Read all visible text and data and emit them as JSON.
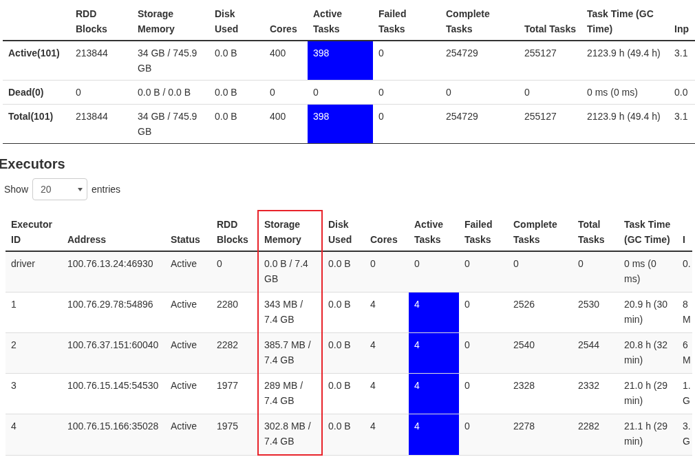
{
  "summary": {
    "columns": [
      "RDD Blocks",
      "Storage Memory",
      "Disk Used",
      "Cores",
      "Active Tasks",
      "Failed Tasks",
      "Complete Tasks",
      "Total Tasks",
      "Task Time (GC Time)",
      "Inp"
    ],
    "rows": [
      {
        "label": "Active(101)",
        "cells": [
          {
            "text": "213844"
          },
          {
            "text": "34 GB / 745.9 GB"
          },
          {
            "text": "0.0 B"
          },
          {
            "text": "400"
          },
          {
            "text": "398",
            "highlighted": true
          },
          {
            "text": "0"
          },
          {
            "text": "254729"
          },
          {
            "text": "255127"
          },
          {
            "text": "2123.9 h (49.4 h)"
          },
          {
            "text": "3.1"
          }
        ]
      },
      {
        "label": "Dead(0)",
        "cells": [
          {
            "text": "0"
          },
          {
            "text": "0.0 B / 0.0 B"
          },
          {
            "text": "0.0 B"
          },
          {
            "text": "0"
          },
          {
            "text": "0",
            "highlighted": false
          },
          {
            "text": "0"
          },
          {
            "text": "0"
          },
          {
            "text": "0"
          },
          {
            "text": "0 ms (0 ms)"
          },
          {
            "text": "0.0"
          }
        ]
      },
      {
        "label": "Total(101)",
        "cells": [
          {
            "text": "213844"
          },
          {
            "text": "34 GB / 745.9 GB"
          },
          {
            "text": "0.0 B"
          },
          {
            "text": "400"
          },
          {
            "text": "398",
            "highlighted": true
          },
          {
            "text": "0"
          },
          {
            "text": "254729"
          },
          {
            "text": "255127"
          },
          {
            "text": "2123.9 h (49.4 h)"
          },
          {
            "text": "3.1"
          }
        ]
      }
    ]
  },
  "executors": {
    "title": "Executors",
    "show_label": "Show",
    "page_size": "20",
    "entries_label": "entries",
    "columns": [
      {
        "label": "Executor ID",
        "outlined": false
      },
      {
        "label": "Address",
        "outlined": false
      },
      {
        "label": "Status",
        "outlined": false
      },
      {
        "label": "RDD Blocks",
        "outlined": false
      },
      {
        "label": "Storage Memory",
        "outlined": true
      },
      {
        "label": "Disk Used",
        "outlined": false
      },
      {
        "label": "Cores",
        "outlined": false
      },
      {
        "label": "Active Tasks",
        "outlined": false
      },
      {
        "label": "Failed Tasks",
        "outlined": false
      },
      {
        "label": "Complete Tasks",
        "outlined": false
      },
      {
        "label": "Total Tasks",
        "outlined": false
      },
      {
        "label": "Task Time (GC Time)",
        "outlined": false
      },
      {
        "label": "I",
        "outlined": false
      }
    ],
    "rows": [
      {
        "cells": [
          {
            "text": "driver"
          },
          {
            "text": "100.76.13.24:46930"
          },
          {
            "text": "Active"
          },
          {
            "text": "0"
          },
          {
            "text": "0.0 B / 7.4 GB"
          },
          {
            "text": "0.0 B"
          },
          {
            "text": "0"
          },
          {
            "text": "0",
            "highlighted": false
          },
          {
            "text": "0"
          },
          {
            "text": "0"
          },
          {
            "text": "0"
          },
          {
            "text": "0 ms (0 ms)"
          },
          {
            "text": "0."
          }
        ]
      },
      {
        "cells": [
          {
            "text": "1"
          },
          {
            "text": "100.76.29.78:54896"
          },
          {
            "text": "Active"
          },
          {
            "text": "2280"
          },
          {
            "text": "343 MB / 7.4 GB"
          },
          {
            "text": "0.0 B"
          },
          {
            "text": "4"
          },
          {
            "text": "4",
            "highlighted": true
          },
          {
            "text": "0"
          },
          {
            "text": "2526"
          },
          {
            "text": "2530"
          },
          {
            "text": "20.9 h (30 min)"
          },
          {
            "text": "8 M"
          }
        ]
      },
      {
        "cells": [
          {
            "text": "2"
          },
          {
            "text": "100.76.37.151:60040"
          },
          {
            "text": "Active"
          },
          {
            "text": "2282"
          },
          {
            "text": "385.7 MB / 7.4 GB"
          },
          {
            "text": "0.0 B"
          },
          {
            "text": "4"
          },
          {
            "text": "4",
            "highlighted": true
          },
          {
            "text": "0"
          },
          {
            "text": "2540"
          },
          {
            "text": "2544"
          },
          {
            "text": "20.8 h (32 min)"
          },
          {
            "text": "6 M"
          }
        ]
      },
      {
        "cells": [
          {
            "text": "3"
          },
          {
            "text": "100.76.15.145:54530"
          },
          {
            "text": "Active"
          },
          {
            "text": "1977"
          },
          {
            "text": "289 MB / 7.4 GB"
          },
          {
            "text": "0.0 B"
          },
          {
            "text": "4"
          },
          {
            "text": "4",
            "highlighted": true
          },
          {
            "text": "0"
          },
          {
            "text": "2328"
          },
          {
            "text": "2332"
          },
          {
            "text": "21.0 h (29 min)"
          },
          {
            "text": "1. G"
          }
        ]
      },
      {
        "cells": [
          {
            "text": "4"
          },
          {
            "text": "100.76.15.166:35028"
          },
          {
            "text": "Active"
          },
          {
            "text": "1975"
          },
          {
            "text": "302.8 MB / 7.4 GB"
          },
          {
            "text": "0.0 B"
          },
          {
            "text": "4"
          },
          {
            "text": "4",
            "highlighted": true
          },
          {
            "text": "0"
          },
          {
            "text": "2278"
          },
          {
            "text": "2282"
          },
          {
            "text": "21.1 h (29 min)"
          },
          {
            "text": "3. G"
          }
        ]
      }
    ]
  }
}
